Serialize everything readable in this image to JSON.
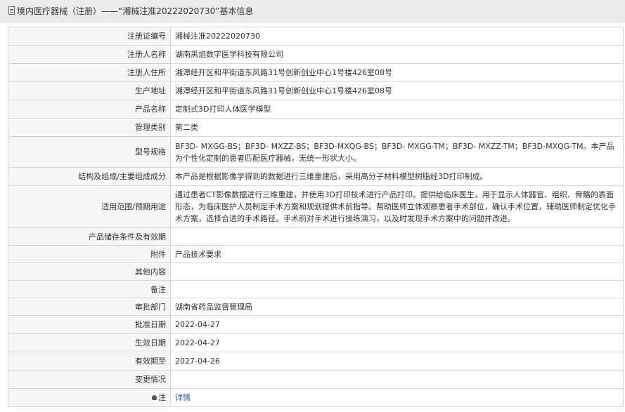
{
  "header": {
    "title": "境内医疗器械（注册）——“湘械注准20222020730”基本信息"
  },
  "rows": [
    {
      "label": "注册证编号",
      "value": "湘械注准20222020730",
      "h": 26
    },
    {
      "label": "注册人名称",
      "value": "湖南黑焰数字医学科技有限公司",
      "h": 26
    },
    {
      "label": "注册人住所",
      "value": "湘潭经开区和平街道东风路31号创新创业中心1号楼426室08号",
      "h": 26
    },
    {
      "label": "生产地址",
      "value": "湘潭经开区和平街道东风路31号创新创业中心1号楼426室08号",
      "h": 26
    },
    {
      "label": "产品名称",
      "value": "定制式3D打印人体医学模型",
      "h": 26
    },
    {
      "label": "管理类别",
      "value": "第二类",
      "h": 26
    },
    {
      "label": "型号规格",
      "value": "BF3D- MXGG-BS；BF3D- MXZZ-BS；BF3D-MXQG-BS；BF3D- MXGG-TM；BF3D- MXZZ-TM；BF3D-MXQG-TM。本产品为个性化定制的患者匹配医疗器械，无统一形状大小。",
      "h": 44
    },
    {
      "label": "结构及组成/主要组成成分",
      "value": "本产品是根据影像学得到的数据进行三维重建后，采用高分子材料模型树脂经3D打印制成。",
      "h": 26
    },
    {
      "label": "适用范围/预期用途",
      "value": "通过患者CT影像数据进行三维重建，并使用3D打印技术进行产品打印。提供给临床医生，用于显示人体器官、组织、骨骼的表面形态，为临床医护人员制定手术方案和规划提供术前指导。帮助医师立体观察患者手术部位，确认手术位置，辅助医师制定优化手术方案，选择合适的手术路径。手术前对手术进行操练演习，以及时发现手术方案中的问题并改进。",
      "h": 60
    },
    {
      "label": "产品储存条件及有效期",
      "value": "",
      "h": 25
    },
    {
      "label": "附件",
      "value": "产品技术要求",
      "h": 25
    },
    {
      "label": "其他内容",
      "value": "",
      "h": 25
    },
    {
      "label": "备注",
      "value": "",
      "h": 25
    },
    {
      "label": "审批部门",
      "value": "湖南省药品监督管理局",
      "h": 25
    },
    {
      "label": "批准日期",
      "value": "2022-04-27",
      "h": 26
    },
    {
      "label": "生效日期",
      "value": "2022-04-27",
      "h": 26
    },
    {
      "label": "有效期至",
      "value": "2027-04-26",
      "h": 26
    },
    {
      "label": "变更情况",
      "value": "",
      "h": 26
    }
  ],
  "note": {
    "label": "注",
    "link": "详情"
  }
}
